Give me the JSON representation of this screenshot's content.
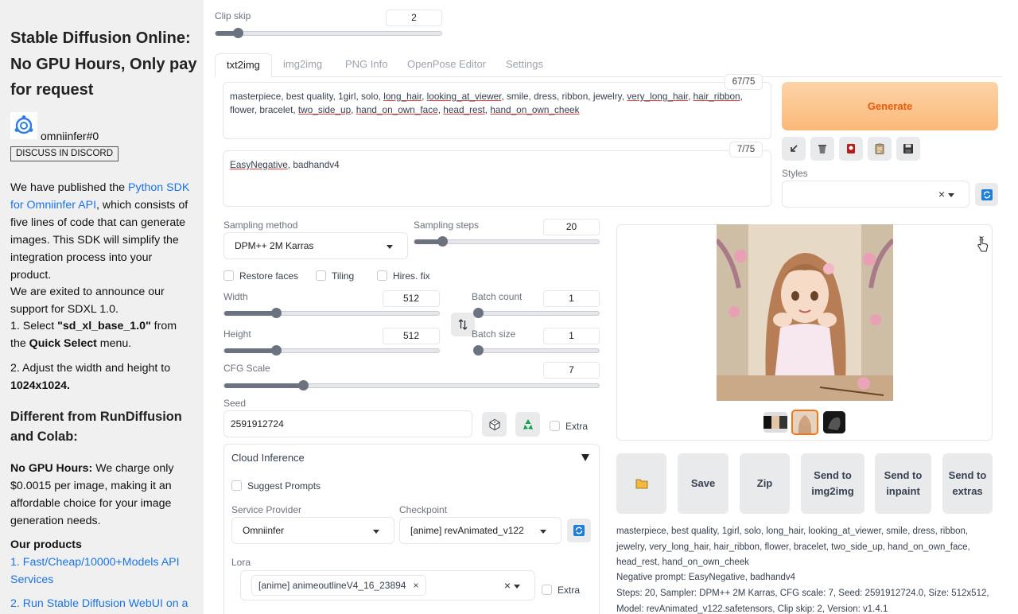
{
  "sidebar": {
    "title": "Stable Diffusion Online: No GPU Hours, Only pay for request",
    "username": "omniinfer#0",
    "discord_button": "DISCUSS IN DISCORD",
    "para1_prefix": "We have published the ",
    "para1_link": "Python SDK for Omniinfer API",
    "para1_suffix": ", which consists of five lines of code that can generate images. This SDK will simplify the integration process into your product.",
    "para2": "We are exited to announce our support for SDXL 1.0.",
    "step1_prefix": "1. Select ",
    "step1_bold": "\"sd_xl_base_1.0\"",
    "step1_mid": " from the ",
    "step1_bold2": "Quick Select",
    "step1_suffix": " menu.",
    "step2_prefix": "2. Adjust the width and height to ",
    "step2_bold": "1024x1024.",
    "heading_different": "Different from RunDiffusion and Colab:",
    "nogpu_bold": "No GPU Hours:",
    "nogpu_text": " We charge only $0.0015 per image, making it an affordable choice for your image generation needs.",
    "products_heading": "Our products",
    "product1": "1. Fast/Cheap/10000+Models API Services",
    "product2": "2. Run Stable Diffusion WebUI on a"
  },
  "clip_skip": {
    "label": "Clip skip",
    "value": "2",
    "level": 0.1
  },
  "tabs": [
    {
      "label": "txt2img"
    },
    {
      "label": "img2img"
    },
    {
      "label": "PNG Info"
    },
    {
      "label": "OpenPose Editor"
    },
    {
      "label": "Settings"
    }
  ],
  "prompt": {
    "counter": "67/75",
    "parts": [
      "masterpiece, best quality, 1girl, solo, ",
      "long_hair",
      ", ",
      "looking_at_viewer",
      ", smile, dress, ribbon, jewelry, ",
      "very_long_hair",
      ", ",
      "hair_ribbon",
      ", flower, bracelet, ",
      "two_side_up",
      ", ",
      "hand_on_own_face",
      ", ",
      "head_rest",
      ", ",
      "hand_on_own_cheek"
    ]
  },
  "negative_prompt": {
    "counter": "7/75",
    "parts": [
      "EasyNegative",
      ", badhandv4"
    ]
  },
  "generate_label": "Generate",
  "styles_label": "Styles",
  "sampling_method": {
    "label": "Sampling method",
    "value": "DPM++ 2M Karras"
  },
  "sampling_steps": {
    "label": "Sampling steps",
    "value": "20",
    "level": 0.15
  },
  "checks": {
    "restore_faces": "Restore faces",
    "tiling": "Tiling",
    "hires_fix": "Hires. fix",
    "extra": "Extra",
    "suggest_prompts": "Suggest Prompts"
  },
  "width": {
    "label": "Width",
    "value": "512",
    "level": 0.24
  },
  "height": {
    "label": "Height",
    "value": "512",
    "level": 0.24
  },
  "batch_count": {
    "label": "Batch count",
    "value": "1",
    "level": 0.0
  },
  "batch_size": {
    "label": "Batch size",
    "value": "1",
    "level": 0.0
  },
  "cfg_scale": {
    "label": "CFG Scale",
    "value": "7",
    "level": 0.21
  },
  "seed": {
    "label": "Seed",
    "value": "2591912724"
  },
  "cloud": {
    "title": "Cloud Inference",
    "service_provider_label": "Service Provider",
    "service_provider_value": "Omniinfer",
    "checkpoint_label": "Checkpoint",
    "checkpoint_value": "[anime] revAnimated_v122",
    "lora_label": "Lora",
    "lora_tag": "[anime] animeoutlineV4_16_23894"
  },
  "actions": {
    "save": "Save",
    "zip": "Zip",
    "send_img2img": "Send to img2img",
    "send_inpaint": "Send to inpaint",
    "send_extras": "Send to extras"
  },
  "generation_info": {
    "line1": "masterpiece, best quality, 1girl, solo, long_hair, looking_at_viewer, smile, dress, ribbon, jewelry, very_long_hair, hair_ribbon, flower, bracelet, two_side_up, hand_on_own_face, head_rest, hand_on_own_cheek",
    "line2": "Negative prompt: EasyNegative, badhandv4",
    "line3": "Steps: 20, Sampler: DPM++ 2M Karras, CFG scale: 7, Seed: 2591912724.0, Size: 512x512, Model: revAnimated_v122.safetensors, Clip skip: 2, Version: v1.4.1"
  },
  "colors": {
    "generate_bg": "#fcc58f",
    "generate_text": "#ea580c",
    "accent_blue": "#1a73e8"
  }
}
